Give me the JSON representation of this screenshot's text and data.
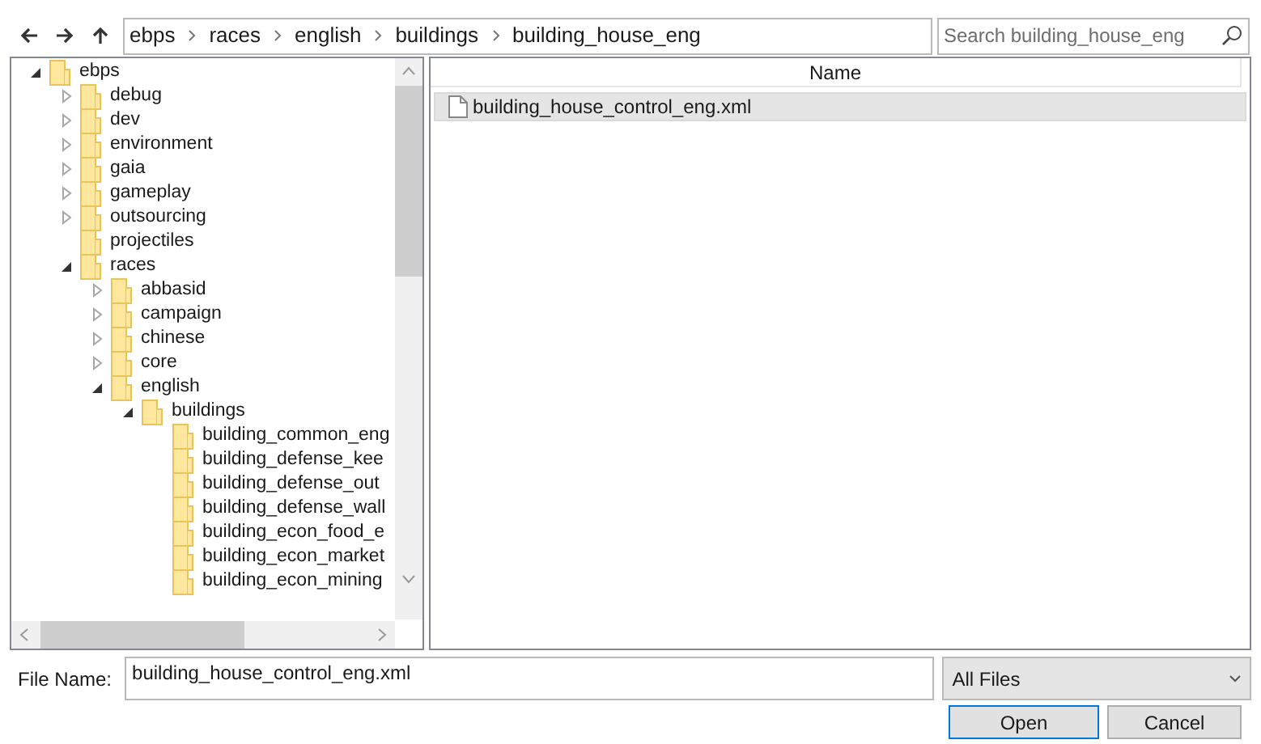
{
  "address_bar": {
    "crumbs": [
      "ebps",
      "races",
      "english",
      "buildings",
      "building_house_eng"
    ]
  },
  "search": {
    "placeholder": "Search building_house_eng"
  },
  "tree": [
    {
      "label": "ebps",
      "expanded": true,
      "children": [
        {
          "label": "debug",
          "expanded": false
        },
        {
          "label": "dev",
          "expanded": false
        },
        {
          "label": "environment",
          "expanded": false
        },
        {
          "label": "gaia",
          "expanded": false
        },
        {
          "label": "gameplay",
          "expanded": false
        },
        {
          "label": "outsourcing",
          "expanded": false
        },
        {
          "label": "projectiles"
        },
        {
          "label": "races",
          "expanded": true,
          "children": [
            {
              "label": "abbasid",
              "expanded": false
            },
            {
              "label": "campaign",
              "expanded": false
            },
            {
              "label": "chinese",
              "expanded": false
            },
            {
              "label": "core",
              "expanded": false
            },
            {
              "label": "english",
              "expanded": true,
              "children": [
                {
                  "label": "buildings",
                  "expanded": true,
                  "children": [
                    {
                      "label": "building_common_eng"
                    },
                    {
                      "label": "building_defense_kee"
                    },
                    {
                      "label": "building_defense_out"
                    },
                    {
                      "label": "building_defense_wall"
                    },
                    {
                      "label": "building_econ_food_e"
                    },
                    {
                      "label": "building_econ_market"
                    },
                    {
                      "label": "building_econ_mining"
                    }
                  ]
                }
              ]
            }
          ]
        }
      ]
    }
  ],
  "file_list": {
    "columns": [
      "Name"
    ],
    "rows": [
      {
        "name": "building_house_control_eng.xml",
        "selected": true
      }
    ]
  },
  "file_name": {
    "label": "File Name:",
    "value": "building_house_control_eng.xml"
  },
  "file_type": {
    "value": "All Files"
  },
  "buttons": [
    {
      "label": "Open",
      "default": true
    },
    {
      "label": "Cancel",
      "default": false
    }
  ]
}
